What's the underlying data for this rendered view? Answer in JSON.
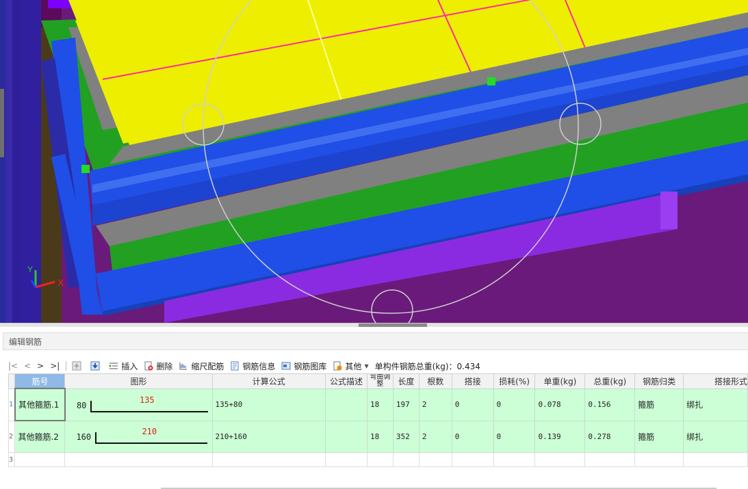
{
  "panel": {
    "title": "编辑钢筋"
  },
  "toolbar": {
    "nav": [
      "|<",
      "<",
      ">",
      ">|"
    ],
    "insert": "插入",
    "delete": "删除",
    "scale_rebar": "缩尺配筋",
    "rebar_info": "钢筋信息",
    "rebar_library": "钢筋图库",
    "other": "其他",
    "total_weight": "单构件钢筋总重(kg)：0.434"
  },
  "axes": {
    "x": "X",
    "y": "Y"
  },
  "grid": {
    "columns": [
      "筋号",
      "图形",
      "计算公式",
      "公式描述",
      "弯曲调整",
      "长度",
      "根数",
      "搭接",
      "损耗(%)",
      "单重(kg)",
      "总重(kg)",
      "钢筋归类",
      "搭接形式"
    ],
    "rows": [
      {
        "num": "1",
        "name": "其他箍筋.1",
        "shape_left": "80",
        "shape_top": "135",
        "formula": "135+80",
        "desc": "",
        "bend": "18",
        "length": "197",
        "count": "2",
        "lap": "0",
        "loss": "0",
        "unit_weight": "0.078",
        "total_weight": "0.156",
        "category": "箍筋",
        "lap_type": "绑扎"
      },
      {
        "num": "2",
        "name": "其他箍筋.2",
        "shape_left": "160",
        "shape_top": "210",
        "formula": "210+160",
        "desc": "",
        "bend": "18",
        "length": "352",
        "count": "2",
        "lap": "0",
        "loss": "0",
        "unit_weight": "0.139",
        "total_weight": "0.278",
        "category": "箍筋",
        "lap_type": "绑扎"
      }
    ],
    "empty_row_num": "3"
  },
  "colors": {
    "slab": "#eeee00",
    "beam_blue": "#1f4fe6",
    "green": "#22a022",
    "purple": "#5a0a5a",
    "violet": "#8a2be2",
    "header_highlight": "#8fb9e6",
    "row_green": "#ccffd6"
  }
}
